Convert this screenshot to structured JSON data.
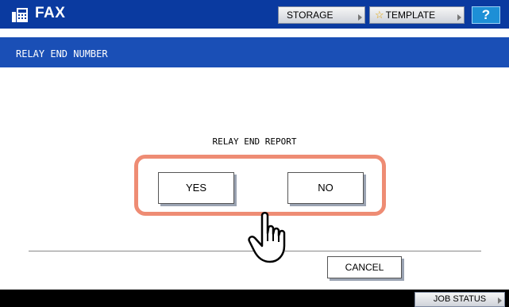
{
  "header": {
    "app_title": "FAX",
    "storage_label": "STORAGE",
    "template_label": "TEMPLATE",
    "help_label": "?",
    "icons": {
      "app": "fax-machine-icon",
      "template": "star-icon"
    }
  },
  "title_bar": {
    "title": "RELAY END NUMBER"
  },
  "main": {
    "prompt": "RELAY END REPORT",
    "options": {
      "yes_label": "YES",
      "no_label": "NO"
    },
    "cancel_label": "CANCEL",
    "pointer_icon": "pointing-hand-icon"
  },
  "footer": {
    "job_status_label": "JOB STATUS"
  },
  "colors": {
    "header_bg": "#0a3aa0",
    "title_bar_bg": "#1a4fb6",
    "help_bg": "#1d8fd6",
    "highlight_border": "#ee8c74",
    "star": "#e4a400"
  }
}
